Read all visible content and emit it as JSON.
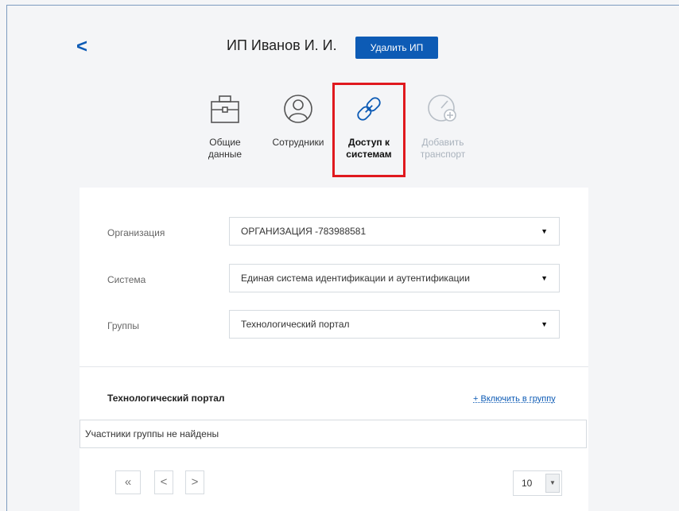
{
  "header": {
    "back_icon": "chevron-left-icon",
    "back_label": "<",
    "title": "ИП Иванов И. И.",
    "delete_label": "Удалить ИП"
  },
  "nav": {
    "items": [
      {
        "label_line1": "Общие",
        "label_line2": "данные",
        "icon": "briefcase-icon",
        "state": "normal"
      },
      {
        "label_line1": "Сотрудники",
        "label_line2": "",
        "icon": "person-icon",
        "state": "normal"
      },
      {
        "label_line1": "Доступ к",
        "label_line2": "системам",
        "icon": "link-icon",
        "state": "active"
      },
      {
        "label_line1": "Добавить",
        "label_line2": "транспорт",
        "icon": "speedometer-add-icon",
        "state": "disabled"
      }
    ],
    "highlight_color": "#e0191e"
  },
  "form": {
    "organization": {
      "label": "Организация",
      "value": "ОРГАНИЗАЦИЯ -783988581"
    },
    "system": {
      "label": "Система",
      "value": "Единая система идентификации и аутентификации"
    },
    "groups": {
      "label": "Группы",
      "value": "Технологический портал"
    }
  },
  "group_section": {
    "title": "Технологический портал",
    "include_link": "+ Включить в группу",
    "empty_text": "Участники группы не найдены"
  },
  "pager": {
    "first_label": "«",
    "prev_label": "<",
    "next_label": ">",
    "page_size": "10",
    "dropdown_glyph": "▼"
  },
  "colors": {
    "accent": "#0d5bb5",
    "background": "#f4f5f7",
    "panel": "#ffffff"
  }
}
